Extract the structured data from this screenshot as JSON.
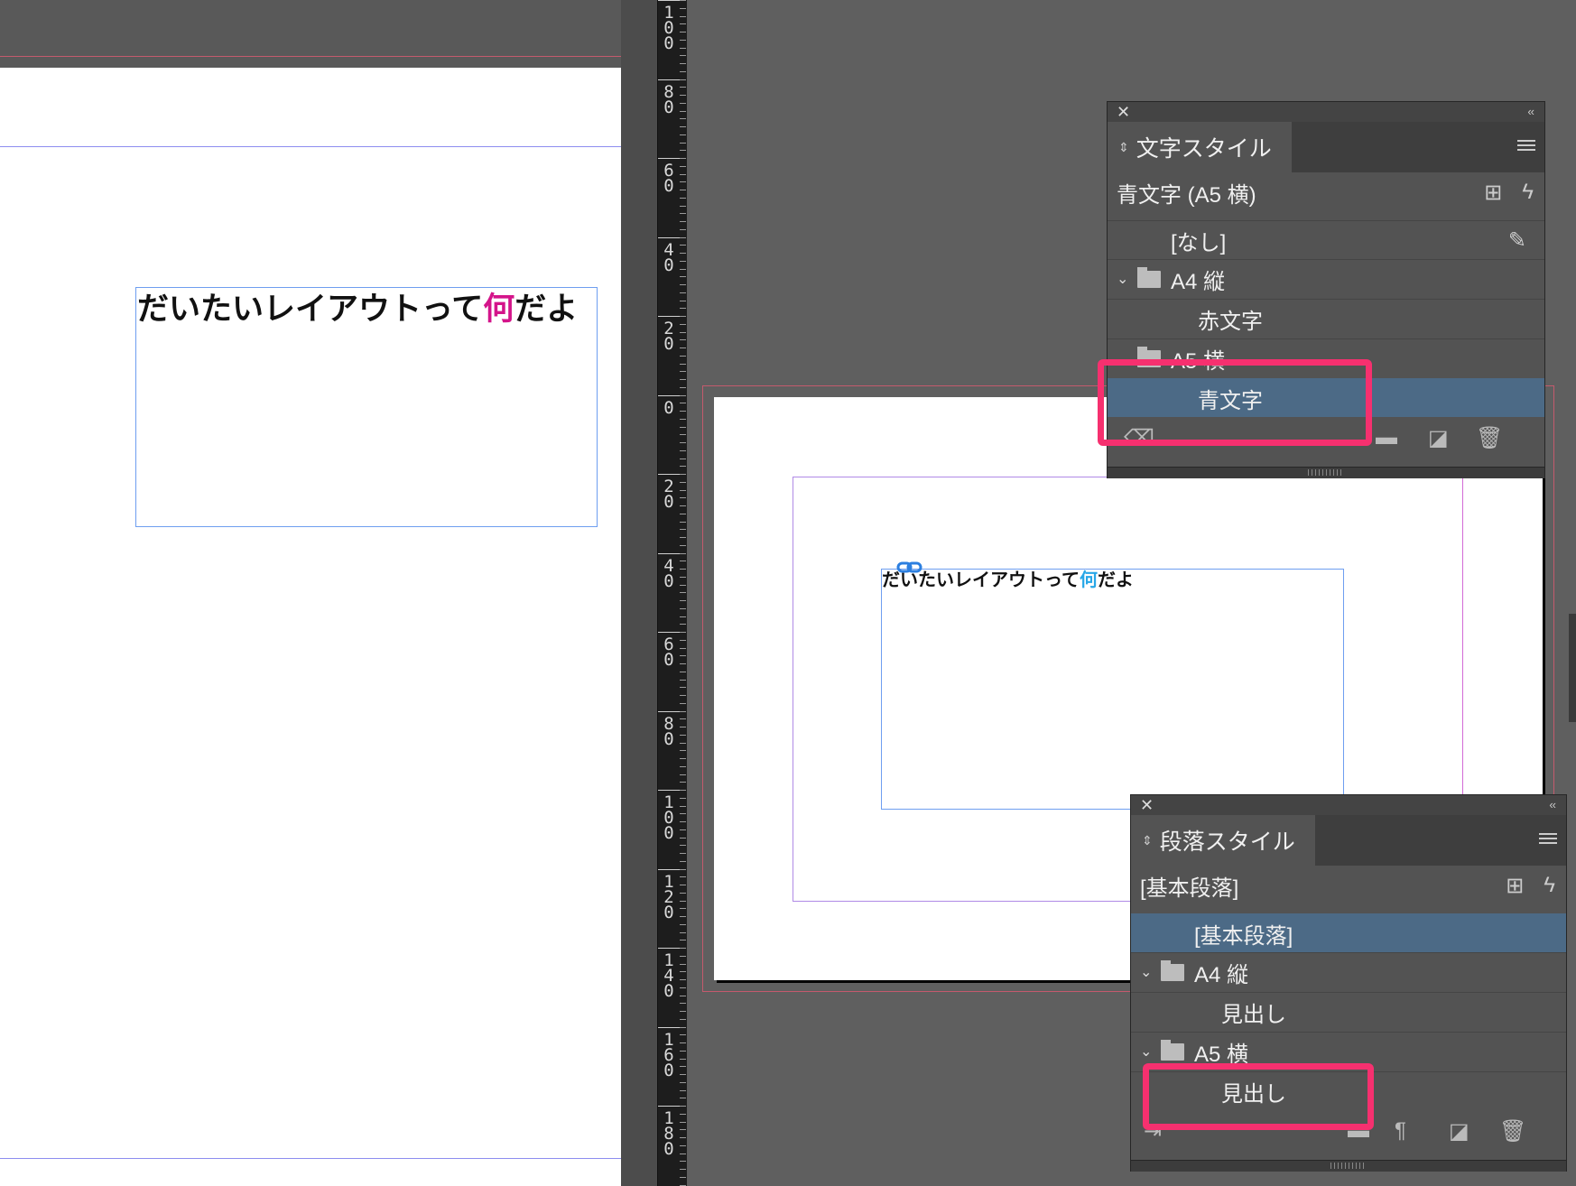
{
  "left_canvas": {
    "text_before": "だいたいレイアウトって",
    "text_highlight": "何",
    "text_after": "だよ",
    "highlight_color": "#d4148a"
  },
  "ruler": {
    "labels": [
      "100",
      "80",
      "60",
      "40",
      "20",
      "0",
      "20",
      "40",
      "60",
      "80",
      "100",
      "120",
      "140",
      "160",
      "180"
    ]
  },
  "right_canvas": {
    "text_before": "だいたいレイアウトって",
    "text_highlight": "何",
    "text_after": "だよ",
    "highlight_color": "#27a7e7"
  },
  "char_styles_panel": {
    "tab_label": "文字スタイル",
    "current_style": "青文字 (A5 横)",
    "items": [
      {
        "label": "[なし]",
        "type": "style"
      },
      {
        "label": "A4 縦",
        "type": "group"
      },
      {
        "label": "赤文字",
        "type": "style"
      },
      {
        "label": "A5 横",
        "type": "group"
      },
      {
        "label": "青文字",
        "type": "style",
        "selected": true
      }
    ]
  },
  "para_styles_panel": {
    "tab_label": "段落スタイル",
    "current_style": "[基本段落]",
    "items": [
      {
        "label": "[基本段落]",
        "type": "style",
        "selected": true
      },
      {
        "label": "A4 縦",
        "type": "group"
      },
      {
        "label": "見出し",
        "type": "style"
      },
      {
        "label": "A5 横",
        "type": "group"
      },
      {
        "label": "見出し",
        "type": "style"
      }
    ]
  },
  "icons": {
    "close": "close-icon",
    "collapse": "collapse-icon",
    "menu": "panel-menu-icon",
    "new_style": "new-style-icon",
    "quick_apply": "lightning-icon",
    "clear_override": "eraser-icon",
    "folder": "folder-icon",
    "new_item": "new-item-icon",
    "trash": "trash-icon"
  },
  "colors": {
    "highlight_box": "#f6306f",
    "selected_row": "#4c6a86"
  }
}
